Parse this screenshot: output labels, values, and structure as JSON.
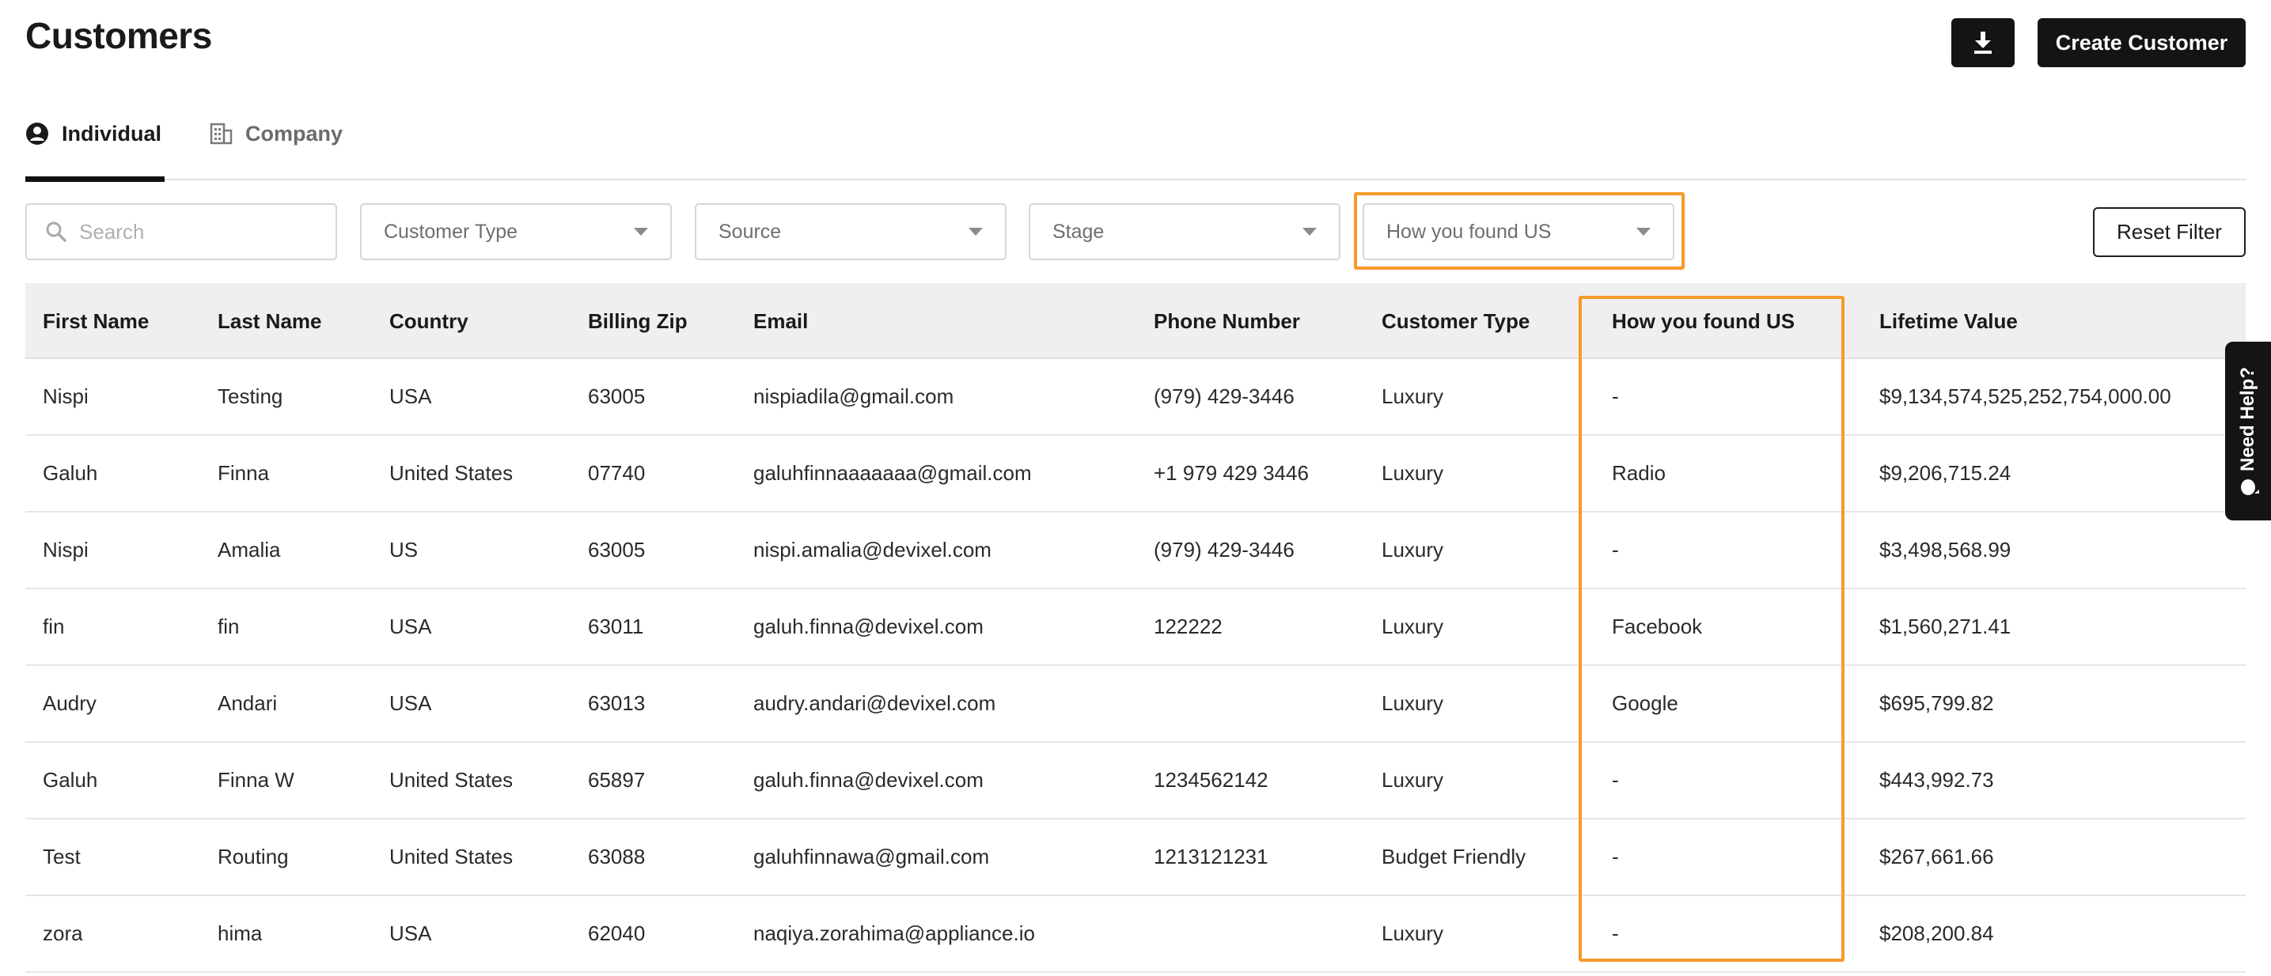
{
  "header": {
    "title": "Customers",
    "create_label": "Create Customer",
    "download_icon": "download-icon"
  },
  "tabs": [
    {
      "label": "Individual",
      "icon": "user-circle-icon",
      "active": true
    },
    {
      "label": "Company",
      "icon": "building-icon",
      "active": false
    }
  ],
  "filters": {
    "search_placeholder": "Search",
    "customer_type": "Customer Type",
    "source": "Source",
    "stage": "Stage",
    "how_found": "How you found US",
    "reset_label": "Reset Filter"
  },
  "table": {
    "columns": [
      "First Name",
      "Last Name",
      "Country",
      "Billing Zip",
      "Email",
      "Phone Number",
      "Customer Type",
      "How you found US",
      "Lifetime Value"
    ],
    "rows": [
      [
        "Nispi",
        "Testing",
        "USA",
        "63005",
        "nispiadila@gmail.com",
        "(979) 429-3446",
        "Luxury",
        "-",
        "$9,134,574,525,252,754,000.00"
      ],
      [
        "Galuh",
        "Finna",
        "United States",
        "07740",
        "galuhfinnaaaaaaa@gmail.com",
        "+1 979 429 3446",
        "Luxury",
        "Radio",
        "$9,206,715.24"
      ],
      [
        "Nispi",
        "Amalia",
        "US",
        "63005",
        "nispi.amalia@devixel.com",
        "(979) 429-3446",
        "Luxury",
        "-",
        "$3,498,568.99"
      ],
      [
        "fin",
        "fin",
        "USA",
        "63011",
        "galuh.finna@devixel.com",
        "122222",
        "Luxury",
        "Facebook",
        "$1,560,271.41"
      ],
      [
        "Audry",
        "Andari",
        "USA",
        "63013",
        "audry.andari@devixel.com",
        "",
        "Luxury",
        "Google",
        "$695,799.82"
      ],
      [
        "Galuh",
        "Finna W",
        "United States",
        "65897",
        "galuh.finna@devixel.com",
        "1234562142",
        "Luxury",
        "-",
        "$443,992.73"
      ],
      [
        "Test",
        "Routing",
        "United States",
        "63088",
        "galuhfinnawa@gmail.com",
        "1213121231",
        "Budget Friendly",
        "-",
        "$267,661.66"
      ],
      [
        "zora",
        "hima",
        "USA",
        "62040",
        "naqiya.zorahima@appliance.io",
        "",
        "Luxury",
        "-",
        "$208,200.84"
      ]
    ]
  },
  "help": {
    "label": "Need Help?",
    "icon": "chat-bubble-icon"
  },
  "colors": {
    "accent_highlight": "#f79a2a",
    "button_bg": "#141414",
    "header_bg": "#efefef"
  }
}
